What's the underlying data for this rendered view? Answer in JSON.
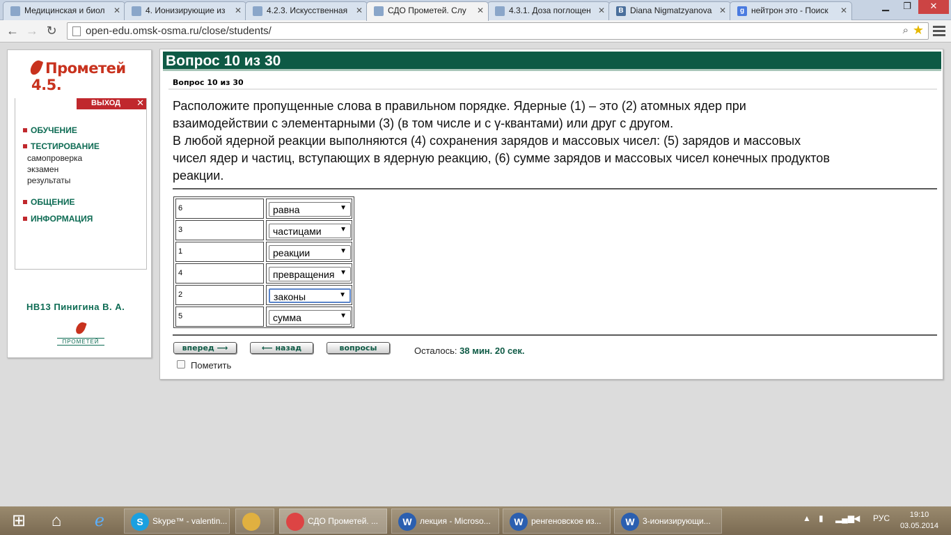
{
  "browser": {
    "tabs": [
      {
        "label": "Медицинская и биол",
        "icon": "doc-icon",
        "color": "#8aa6c9"
      },
      {
        "label": "4. Ионизирующие из",
        "icon": "doc-icon",
        "color": "#8aa6c9"
      },
      {
        "label": "4.2.3. Искусственная",
        "icon": "doc-icon",
        "color": "#8aa6c9"
      },
      {
        "label": "СДО Прометей. Слу",
        "icon": "doc-icon",
        "color": "#8aa6c9"
      },
      {
        "label": "4.3.1. Доза поглощен",
        "icon": "doc-icon",
        "color": "#8aa6c9"
      },
      {
        "label": "Diana Nigmatzyanova",
        "icon": "vk-icon",
        "color": "#4a6f9c"
      },
      {
        "label": "нейтрон это - Поиск",
        "icon": "google-icon",
        "color": "#4a7be0"
      }
    ],
    "active_tab": 3,
    "url": "open-edu.omsk-osma.ru/close/students/"
  },
  "sidebar": {
    "logo": "Прометей 4.5.",
    "exit_label": "ВЫХОД",
    "menu": [
      {
        "label": "ОБУЧЕНИЕ"
      },
      {
        "label": "ТЕСТИРОВАНИЕ"
      },
      {
        "label": "ОБЩЕНИЕ"
      },
      {
        "label": "ИНФОРМАЦИЯ"
      }
    ],
    "submenu": [
      "самопроверка",
      "экзамен",
      "результаты"
    ],
    "student": "НВ13 Пинигина В. А.",
    "bottom_logo": "ПРОМЕТЕЙ"
  },
  "question": {
    "header": "Вопрос 10 из 30",
    "subheader": "Вопрос 10 из 30",
    "text_lines": [
      "Расположите пропущенные слова в правильном порядке. Ядерные (1) – это (2) атомных ядер при",
      "взаимодействии с элементарными (3) (в том числе и с γ-квантами) или друг с другом.",
      "В любой ядерной реакции выполняются (4) сохранения зарядов и массовых чисел: (5) зарядов и массовых",
      "чисел ядер и частиц, вступающих в ядерную реакцию, (6) сумме зарядов и массовых чисел конечных продуктов",
      "реакции."
    ],
    "answers": [
      {
        "num": "6",
        "value": "равна"
      },
      {
        "num": "3",
        "value": "частицами"
      },
      {
        "num": "1",
        "value": "реакции"
      },
      {
        "num": "4",
        "value": "превращения"
      },
      {
        "num": "2",
        "value": "законы"
      },
      {
        "num": "5",
        "value": "сумма"
      }
    ],
    "focused_answer": 4
  },
  "controls": {
    "forward": "вперед",
    "back": "назад",
    "questions": "вопросы",
    "remaining_label": "Осталось:",
    "remaining_value": "38 мин. 20 сек.",
    "mark_label": "Пометить"
  },
  "taskbar": {
    "items": [
      {
        "label": "Skype™ - valentin...",
        "icon": "skype-icon",
        "color": "#1aa0e0"
      },
      {
        "label": "",
        "icon": "folder-icon",
        "color": "#e0b040"
      },
      {
        "label": "СДО Прометей. ...",
        "icon": "chrome-icon",
        "color": "#d44"
      },
      {
        "label": "лекция - Microso...",
        "icon": "word-icon",
        "color": "#2b5fb0"
      },
      {
        "label": "ренгеновское из...",
        "icon": "word-icon",
        "color": "#2b5fb0"
      },
      {
        "label": "3-ионизирующи...",
        "icon": "word-icon",
        "color": "#2b5fb0"
      }
    ],
    "lang": "РУС",
    "time": "19:10",
    "date": "03.05.2014"
  }
}
